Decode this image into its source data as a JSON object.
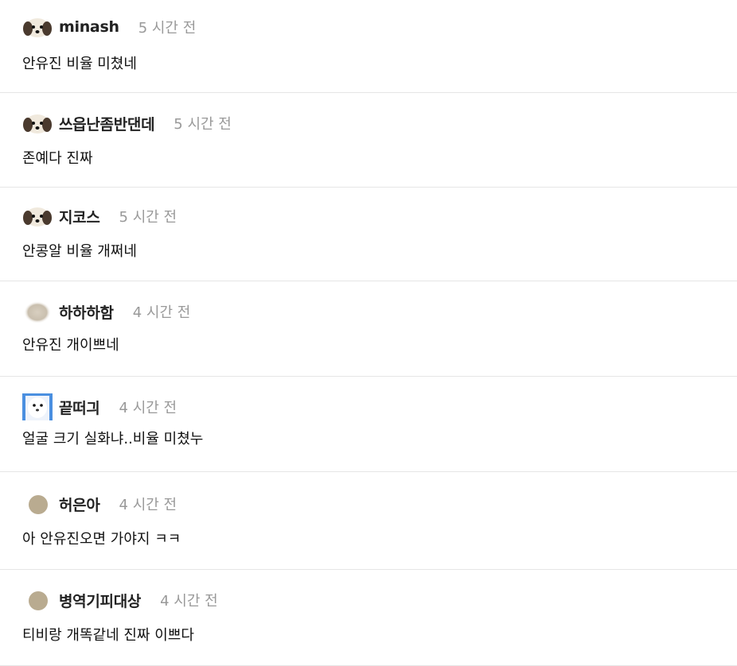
{
  "comments": [
    {
      "author": "minash",
      "time": "5 시간 전",
      "text": "안유진 비율 미쳤네",
      "avatar": "puppy-avatar"
    },
    {
      "author": "쓰읍난좀반댄데",
      "time": "5 시간 전",
      "text": "존예다 진짜",
      "avatar": "puppy-avatar"
    },
    {
      "author": "지코스",
      "time": "5 시간 전",
      "text": "안콩알 비율 개쩌네",
      "avatar": "puppy-avatar"
    },
    {
      "author": "하하하함",
      "time": "4 시간 전",
      "text": "안유진 개이쁘네",
      "avatar": "blur-avatar"
    },
    {
      "author": "끝떠긔",
      "time": "4 시간 전",
      "text": "얼굴 크기 실화냐..비율 미쳤누",
      "avatar": "blue-dog-avatar"
    },
    {
      "author": "허은아",
      "time": "4 시간 전",
      "text": "아 안유진오면 가야지 ㅋㅋ",
      "avatar": "circle-avatar"
    },
    {
      "author": "병역기피대상",
      "time": "4 시간 전",
      "text": "티비랑 개똑같네 진짜 이쁘다",
      "avatar": "circle-avatar"
    }
  ]
}
